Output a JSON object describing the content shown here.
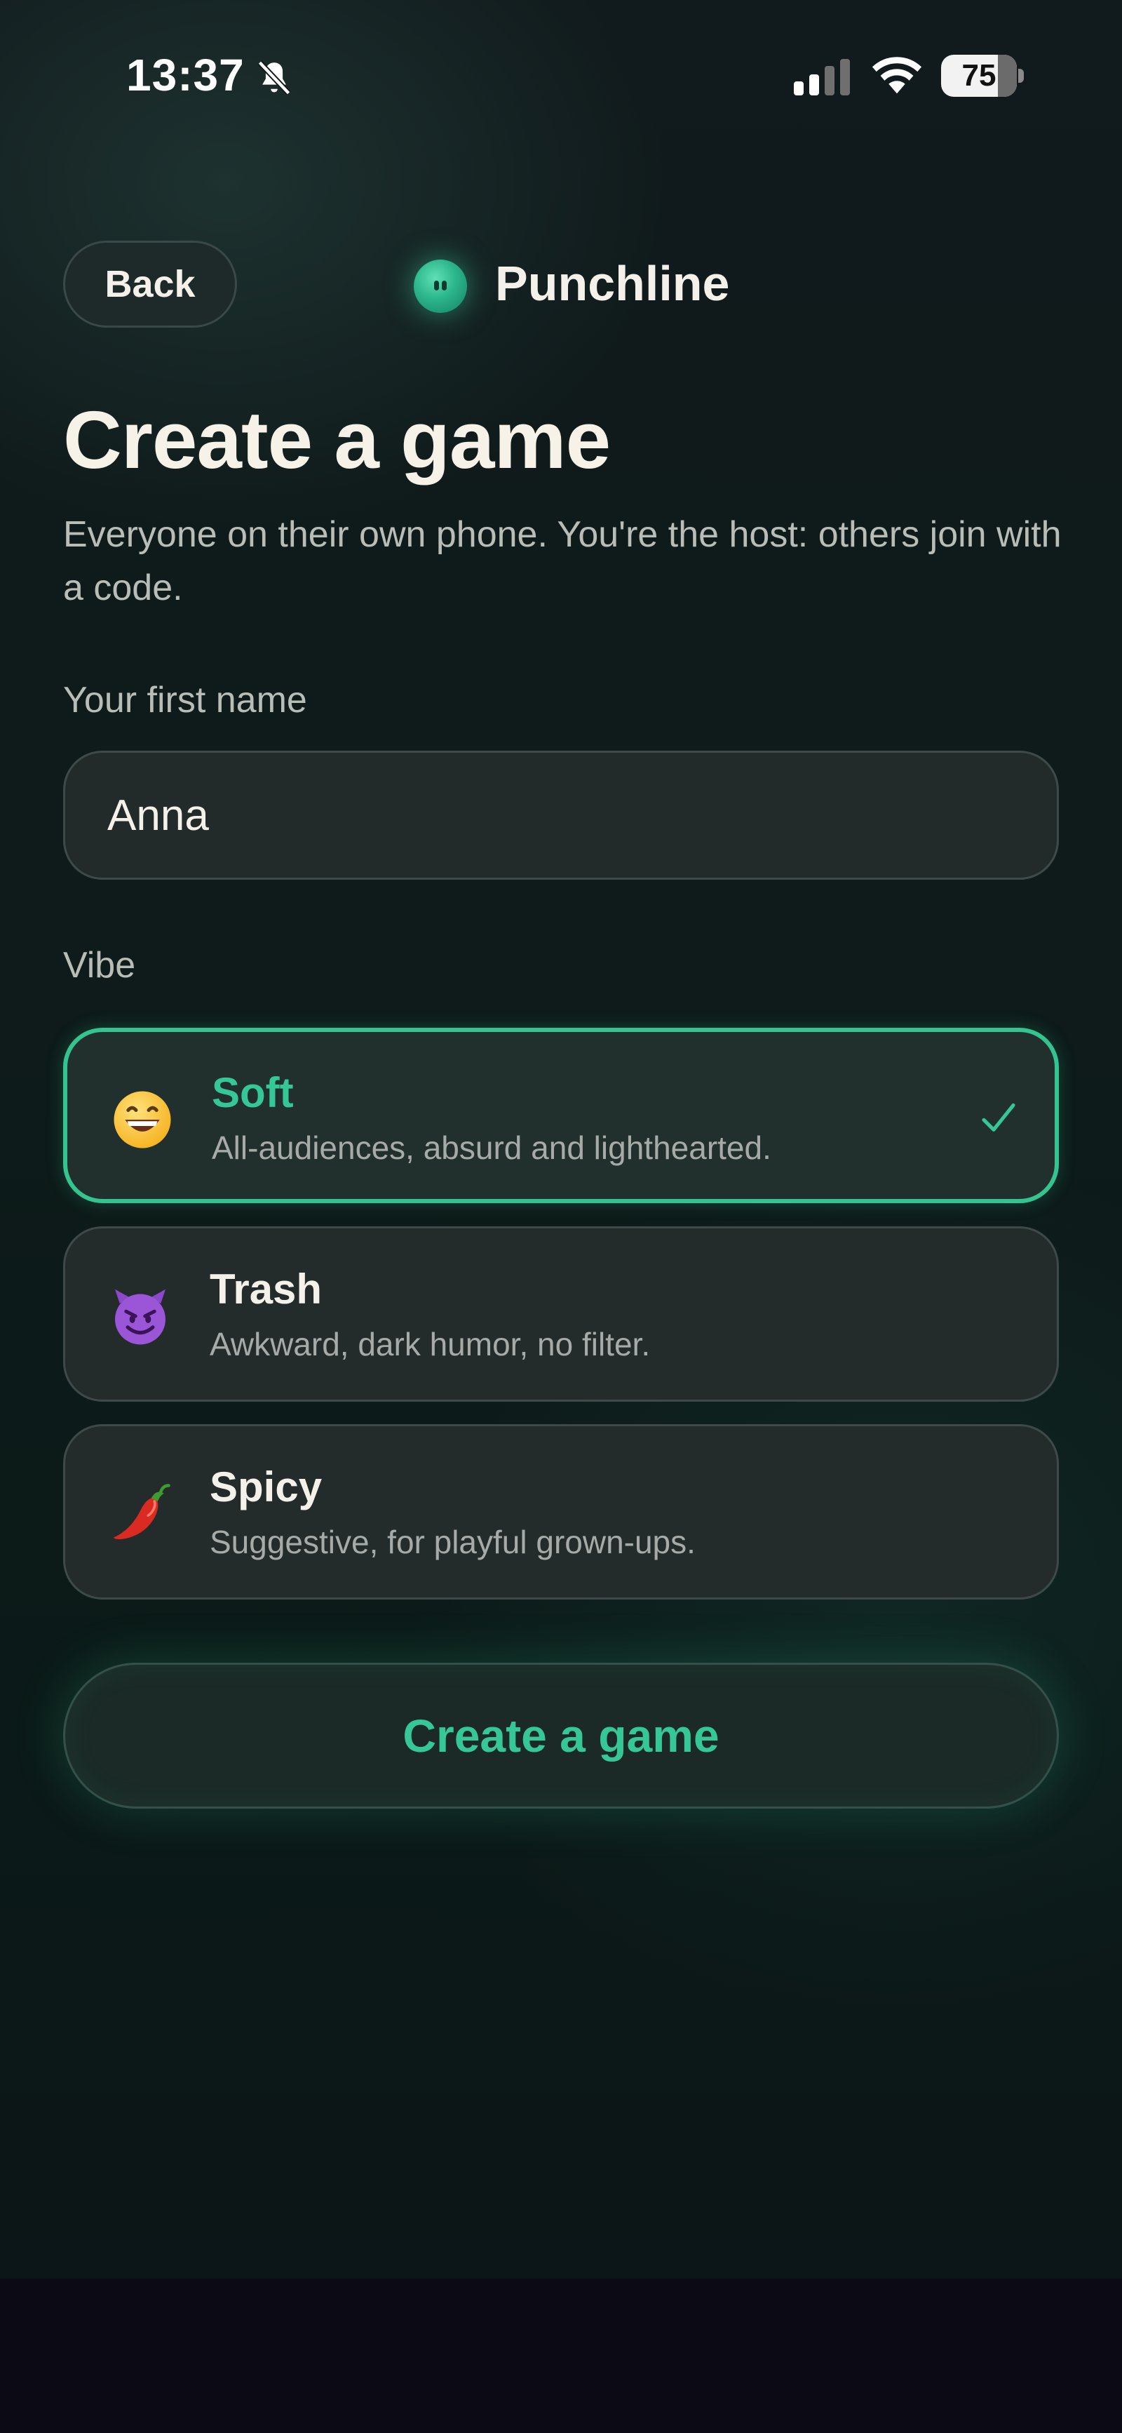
{
  "status_bar": {
    "time": "13:37",
    "battery": "75",
    "battery_level": 0.75
  },
  "header": {
    "back_label": "Back",
    "brand_name": "Punchline"
  },
  "page": {
    "title": "Create a game",
    "subtitle": "Everyone on their own phone. You're the host: others join with a code."
  },
  "form": {
    "name_label": "Your first name",
    "name_value": "Anna",
    "vibe_label": "Vibe",
    "vibes": [
      {
        "title": "Soft",
        "description": "All-audiences, absurd and lighthearted.",
        "icon": "grinning-face-icon",
        "selected": true
      },
      {
        "title": "Trash",
        "description": "Awkward, dark humor, no filter.",
        "icon": "smiling-devil-icon",
        "selected": false
      },
      {
        "title": "Spicy",
        "description": "Suggestive, for playful grown-ups.",
        "icon": "chili-pepper-icon",
        "selected": false
      }
    ],
    "submit_label": "Create a game"
  },
  "colors": {
    "accent": "#35c795",
    "background": "#0e1b1a",
    "card": "#232b2b"
  }
}
